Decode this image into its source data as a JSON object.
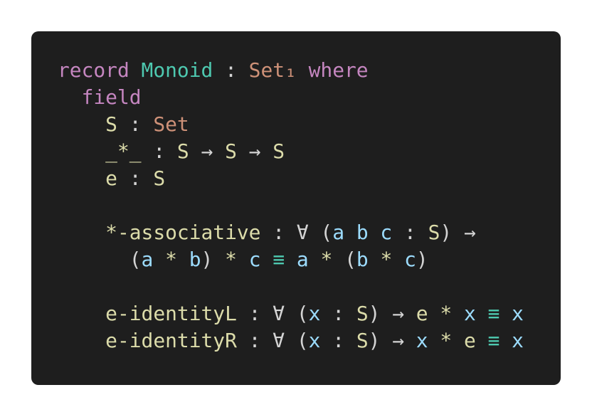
{
  "colors": {
    "background": "#1e1e1e",
    "keyword": "#c586c0",
    "type": "#4ec9b0",
    "sort": "#ce9178",
    "function": "#dcdcaa",
    "variable": "#9cdcfe",
    "plain": "#d4d4d4"
  },
  "code": {
    "language": "Agda",
    "lines": [
      [
        {
          "k": "keyword",
          "t": "record"
        },
        {
          "k": "plain",
          "t": " "
        },
        {
          "k": "type",
          "t": "Monoid"
        },
        {
          "k": "plain",
          "t": " : "
        },
        {
          "k": "sort",
          "t": "Set₁"
        },
        {
          "k": "plain",
          "t": " "
        },
        {
          "k": "keyword",
          "t": "where"
        }
      ],
      [
        {
          "k": "plain",
          "t": "  "
        },
        {
          "k": "keyword",
          "t": "field"
        }
      ],
      [
        {
          "k": "plain",
          "t": "    "
        },
        {
          "k": "func",
          "t": "S"
        },
        {
          "k": "plain",
          "t": " : "
        },
        {
          "k": "sort",
          "t": "Set"
        }
      ],
      [
        {
          "k": "plain",
          "t": "    "
        },
        {
          "k": "func",
          "t": "_*_"
        },
        {
          "k": "plain",
          "t": " : "
        },
        {
          "k": "func",
          "t": "S"
        },
        {
          "k": "plain",
          "t": " → "
        },
        {
          "k": "func",
          "t": "S"
        },
        {
          "k": "plain",
          "t": " → "
        },
        {
          "k": "func",
          "t": "S"
        }
      ],
      [
        {
          "k": "plain",
          "t": "    "
        },
        {
          "k": "func",
          "t": "e"
        },
        {
          "k": "plain",
          "t": " : "
        },
        {
          "k": "func",
          "t": "S"
        }
      ],
      [
        {
          "k": "plain",
          "t": " "
        }
      ],
      [
        {
          "k": "plain",
          "t": "    "
        },
        {
          "k": "func",
          "t": "*-associative"
        },
        {
          "k": "plain",
          "t": " : ∀ ("
        },
        {
          "k": "var",
          "t": "a"
        },
        {
          "k": "plain",
          "t": " "
        },
        {
          "k": "var",
          "t": "b"
        },
        {
          "k": "plain",
          "t": " "
        },
        {
          "k": "var",
          "t": "c"
        },
        {
          "k": "plain",
          "t": " : "
        },
        {
          "k": "func",
          "t": "S"
        },
        {
          "k": "plain",
          "t": ") →"
        }
      ],
      [
        {
          "k": "plain",
          "t": "      ("
        },
        {
          "k": "var",
          "t": "a"
        },
        {
          "k": "plain",
          "t": " "
        },
        {
          "k": "func",
          "t": "*"
        },
        {
          "k": "plain",
          "t": " "
        },
        {
          "k": "var",
          "t": "b"
        },
        {
          "k": "plain",
          "t": ") "
        },
        {
          "k": "func",
          "t": "*"
        },
        {
          "k": "plain",
          "t": " "
        },
        {
          "k": "var",
          "t": "c"
        },
        {
          "k": "plain",
          "t": " "
        },
        {
          "k": "eq",
          "t": "≡"
        },
        {
          "k": "plain",
          "t": " "
        },
        {
          "k": "var",
          "t": "a"
        },
        {
          "k": "plain",
          "t": " "
        },
        {
          "k": "func",
          "t": "*"
        },
        {
          "k": "plain",
          "t": " ("
        },
        {
          "k": "var",
          "t": "b"
        },
        {
          "k": "plain",
          "t": " "
        },
        {
          "k": "func",
          "t": "*"
        },
        {
          "k": "plain",
          "t": " "
        },
        {
          "k": "var",
          "t": "c"
        },
        {
          "k": "plain",
          "t": ")"
        }
      ],
      [
        {
          "k": "plain",
          "t": " "
        }
      ],
      [
        {
          "k": "plain",
          "t": "    "
        },
        {
          "k": "func",
          "t": "e-identityL"
        },
        {
          "k": "plain",
          "t": " : ∀ ("
        },
        {
          "k": "var",
          "t": "x"
        },
        {
          "k": "plain",
          "t": " : "
        },
        {
          "k": "func",
          "t": "S"
        },
        {
          "k": "plain",
          "t": ") → "
        },
        {
          "k": "func",
          "t": "e"
        },
        {
          "k": "plain",
          "t": " "
        },
        {
          "k": "func",
          "t": "*"
        },
        {
          "k": "plain",
          "t": " "
        },
        {
          "k": "var",
          "t": "x"
        },
        {
          "k": "plain",
          "t": " "
        },
        {
          "k": "eq",
          "t": "≡"
        },
        {
          "k": "plain",
          "t": " "
        },
        {
          "k": "var",
          "t": "x"
        }
      ],
      [
        {
          "k": "plain",
          "t": "    "
        },
        {
          "k": "func",
          "t": "e-identityR"
        },
        {
          "k": "plain",
          "t": " : ∀ ("
        },
        {
          "k": "var",
          "t": "x"
        },
        {
          "k": "plain",
          "t": " : "
        },
        {
          "k": "func",
          "t": "S"
        },
        {
          "k": "plain",
          "t": ") → "
        },
        {
          "k": "var",
          "t": "x"
        },
        {
          "k": "plain",
          "t": " "
        },
        {
          "k": "func",
          "t": "*"
        },
        {
          "k": "plain",
          "t": " "
        },
        {
          "k": "func",
          "t": "e"
        },
        {
          "k": "plain",
          "t": " "
        },
        {
          "k": "eq",
          "t": "≡"
        },
        {
          "k": "plain",
          "t": " "
        },
        {
          "k": "var",
          "t": "x"
        }
      ]
    ]
  }
}
